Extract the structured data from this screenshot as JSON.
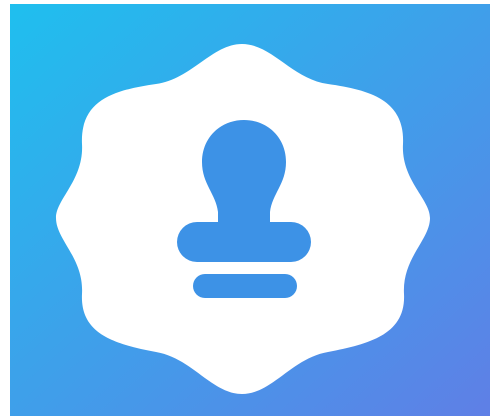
{
  "app_icon": {
    "name": "stamp-app-icon",
    "colors": {
      "gradient_start": "#1fbfee",
      "gradient_end": "#5f7fe6",
      "badge": "#ffffff",
      "stamp": "#3d92e6"
    }
  }
}
